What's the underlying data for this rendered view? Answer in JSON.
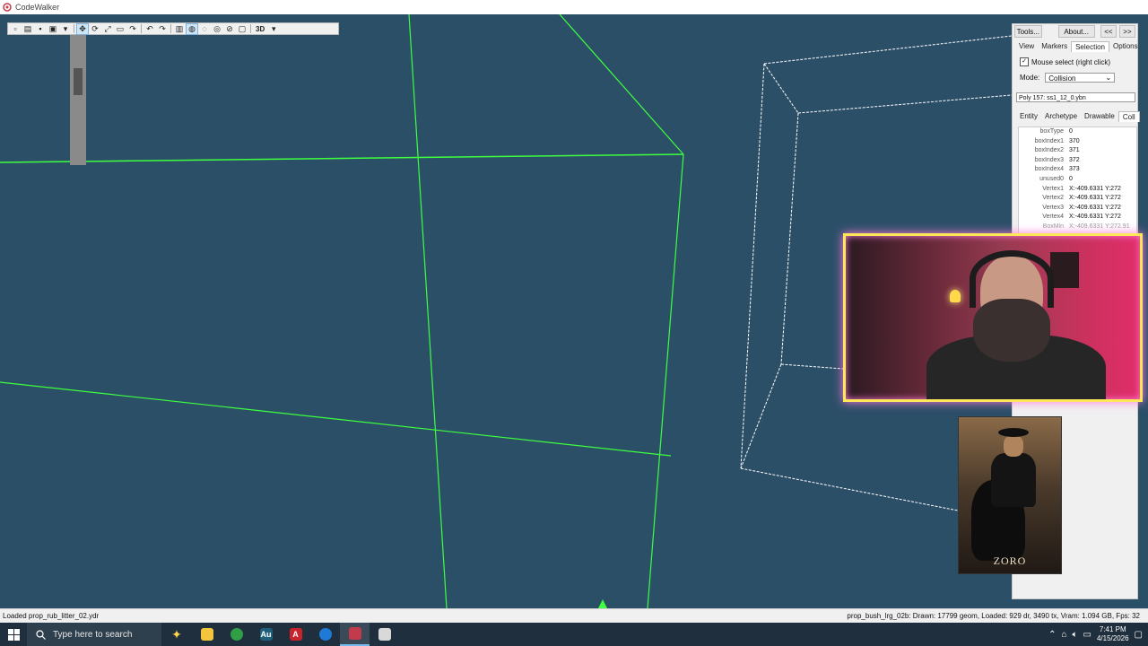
{
  "window": {
    "title": "CodeWalker"
  },
  "toolbar": {
    "mode_3d_label": "3D",
    "icons": [
      "new-icon",
      "open-icon",
      "save-icon",
      "save-all-icon",
      "cube-icon",
      "move-icon",
      "rotate-icon",
      "scale-icon",
      "select-icon",
      "snap-icon",
      "undo-icon",
      "redo-icon",
      "toggle-panel-icon",
      "wireframe-icon",
      "tool-a-icon",
      "tool-b-icon",
      "tool-c-icon",
      "tool-d-icon"
    ]
  },
  "panel": {
    "top_buttons": {
      "tools": "Tools...",
      "about": "About...",
      "collapse": "<<",
      "expand": ">>"
    },
    "tabs": [
      "View",
      "Markers",
      "Selection",
      "Options"
    ],
    "active_tab": "Selection",
    "mouse_select_label": "Mouse select (right click)",
    "mouse_select_checked": true,
    "mode_label": "Mode:",
    "mode_value": "Collision",
    "selected_item": "Poly 157: ss1_12_0.ybn",
    "sub_tabs": [
      "Entity",
      "Archetype",
      "Drawable",
      "Coll"
    ],
    "active_sub_tab": "Coll",
    "properties": [
      {
        "name": "boxType",
        "value": "0"
      },
      {
        "name": "boxIndex1",
        "value": "370"
      },
      {
        "name": "boxIndex2",
        "value": "371"
      },
      {
        "name": "boxIndex3",
        "value": "372"
      },
      {
        "name": "boxIndex4",
        "value": "373"
      },
      {
        "name": "unused0",
        "value": "0"
      },
      {
        "name": "Vertex1",
        "value": "X:-409.6331 Y:272"
      },
      {
        "name": "Vertex2",
        "value": "X:-409.6331 Y:272"
      },
      {
        "name": "Vertex3",
        "value": "X:-409.6331 Y:272"
      },
      {
        "name": "Vertex4",
        "value": "X:-409.6331 Y:272"
      },
      {
        "name": "BoxMin",
        "value": "X:-409.6331 Y:272.91"
      }
    ]
  },
  "overlay": {
    "card_title": "ZORO"
  },
  "status": {
    "left": "Loaded prop_rub_litter_02.ydr",
    "right": "prop_bush_lrg_02b:   Drawn: 17799 geom, Loaded: 929 dr, 3490 tx, Vram: 1.094 GB, Fps: 32"
  },
  "taskbar": {
    "search_placeholder": "Type here to search",
    "apps": [
      {
        "name": "file-explorer-icon",
        "color": "#f3c53c",
        "glyph": ""
      },
      {
        "name": "chrome-icon",
        "color": "#2f9e44",
        "glyph": ""
      },
      {
        "name": "audition-icon",
        "color": "#1f5f7a",
        "glyph": "Au"
      },
      {
        "name": "acrobat-icon",
        "color": "#c9242b",
        "glyph": "A"
      },
      {
        "name": "browser-icon",
        "color": "#1e7ad6",
        "glyph": ""
      },
      {
        "name": "codewalker-app-icon",
        "color": "#c33a4a",
        "glyph": ""
      },
      {
        "name": "game-app-icon",
        "color": "#d9d9d9",
        "glyph": ""
      }
    ],
    "time": "7:41 PM",
    "date": "4/15/2026"
  }
}
